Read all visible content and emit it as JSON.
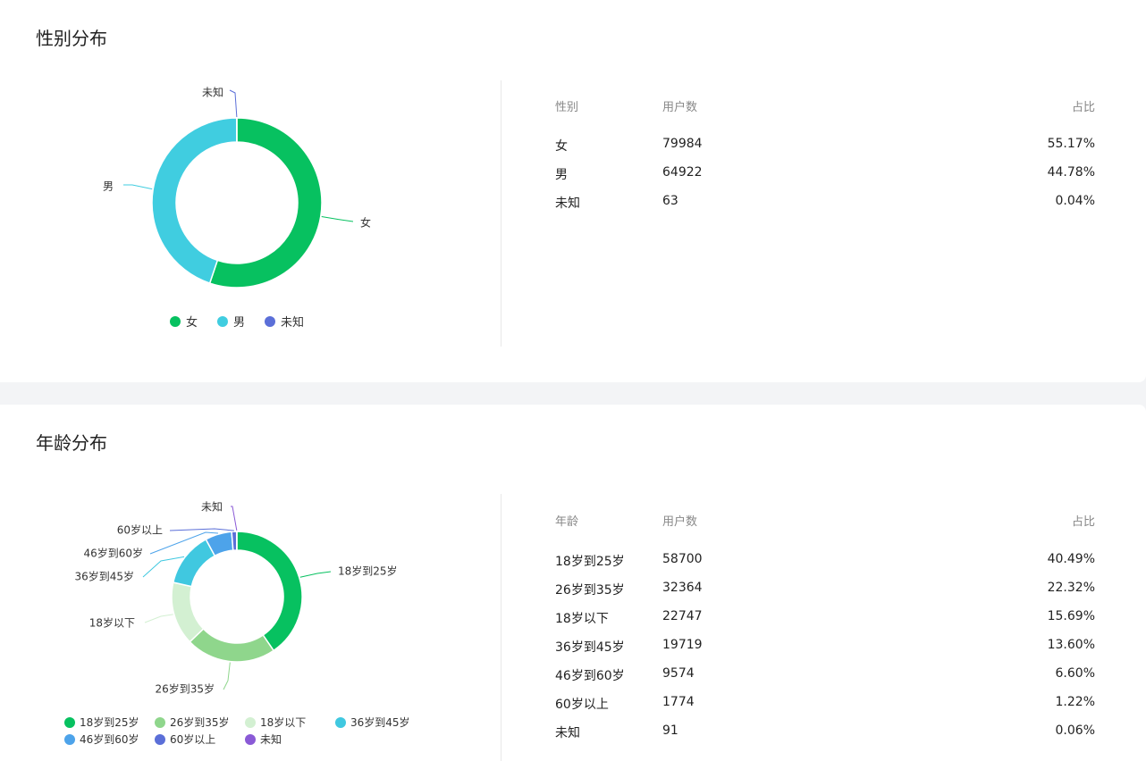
{
  "gender": {
    "title": "性别分布",
    "table": {
      "headers": [
        "性别",
        "用户数",
        "占比"
      ],
      "rows": [
        [
          "女",
          "79984",
          "55.17%"
        ],
        [
          "男",
          "64922",
          "44.78%"
        ],
        [
          "未知",
          "63",
          "0.04%"
        ]
      ]
    },
    "legend": [
      "女",
      "男",
      "未知"
    ]
  },
  "age": {
    "title": "年龄分布",
    "table": {
      "headers": [
        "年龄",
        "用户数",
        "占比"
      ],
      "rows": [
        [
          "18岁到25岁",
          "58700",
          "40.49%"
        ],
        [
          "26岁到35岁",
          "32364",
          "22.32%"
        ],
        [
          "18岁以下",
          "22747",
          "15.69%"
        ],
        [
          "36岁到45岁",
          "19719",
          "13.60%"
        ],
        [
          "46岁到60岁",
          "9574",
          "6.60%"
        ],
        [
          "60岁以上",
          "1774",
          "1.22%"
        ],
        [
          "未知",
          "91",
          "0.06%"
        ]
      ]
    },
    "legend": [
      "18岁到25岁",
      "26岁到35岁",
      "18岁以下",
      "36岁到45岁",
      "46岁到60岁",
      "60岁以上",
      "未知"
    ]
  },
  "chart_data": [
    {
      "type": "pie",
      "donut": true,
      "categories": [
        "女",
        "男",
        "未知"
      ],
      "values": [
        79984,
        64922,
        63
      ],
      "colors": [
        "#07c160",
        "#40cde0",
        "#5b6fd8"
      ],
      "legend_position": "bottom"
    },
    {
      "type": "pie",
      "donut": true,
      "categories": [
        "18岁到25岁",
        "26岁到35岁",
        "18岁以下",
        "36岁到45岁",
        "46岁到60岁",
        "60岁以上",
        "未知"
      ],
      "values": [
        58700,
        32364,
        22747,
        19719,
        9574,
        1774,
        91
      ],
      "colors": [
        "#07c160",
        "#8fd68c",
        "#d3f0d2",
        "#40c8e0",
        "#4da3ea",
        "#5b6fd8",
        "#8a5ad6"
      ],
      "legend_position": "bottom"
    }
  ]
}
